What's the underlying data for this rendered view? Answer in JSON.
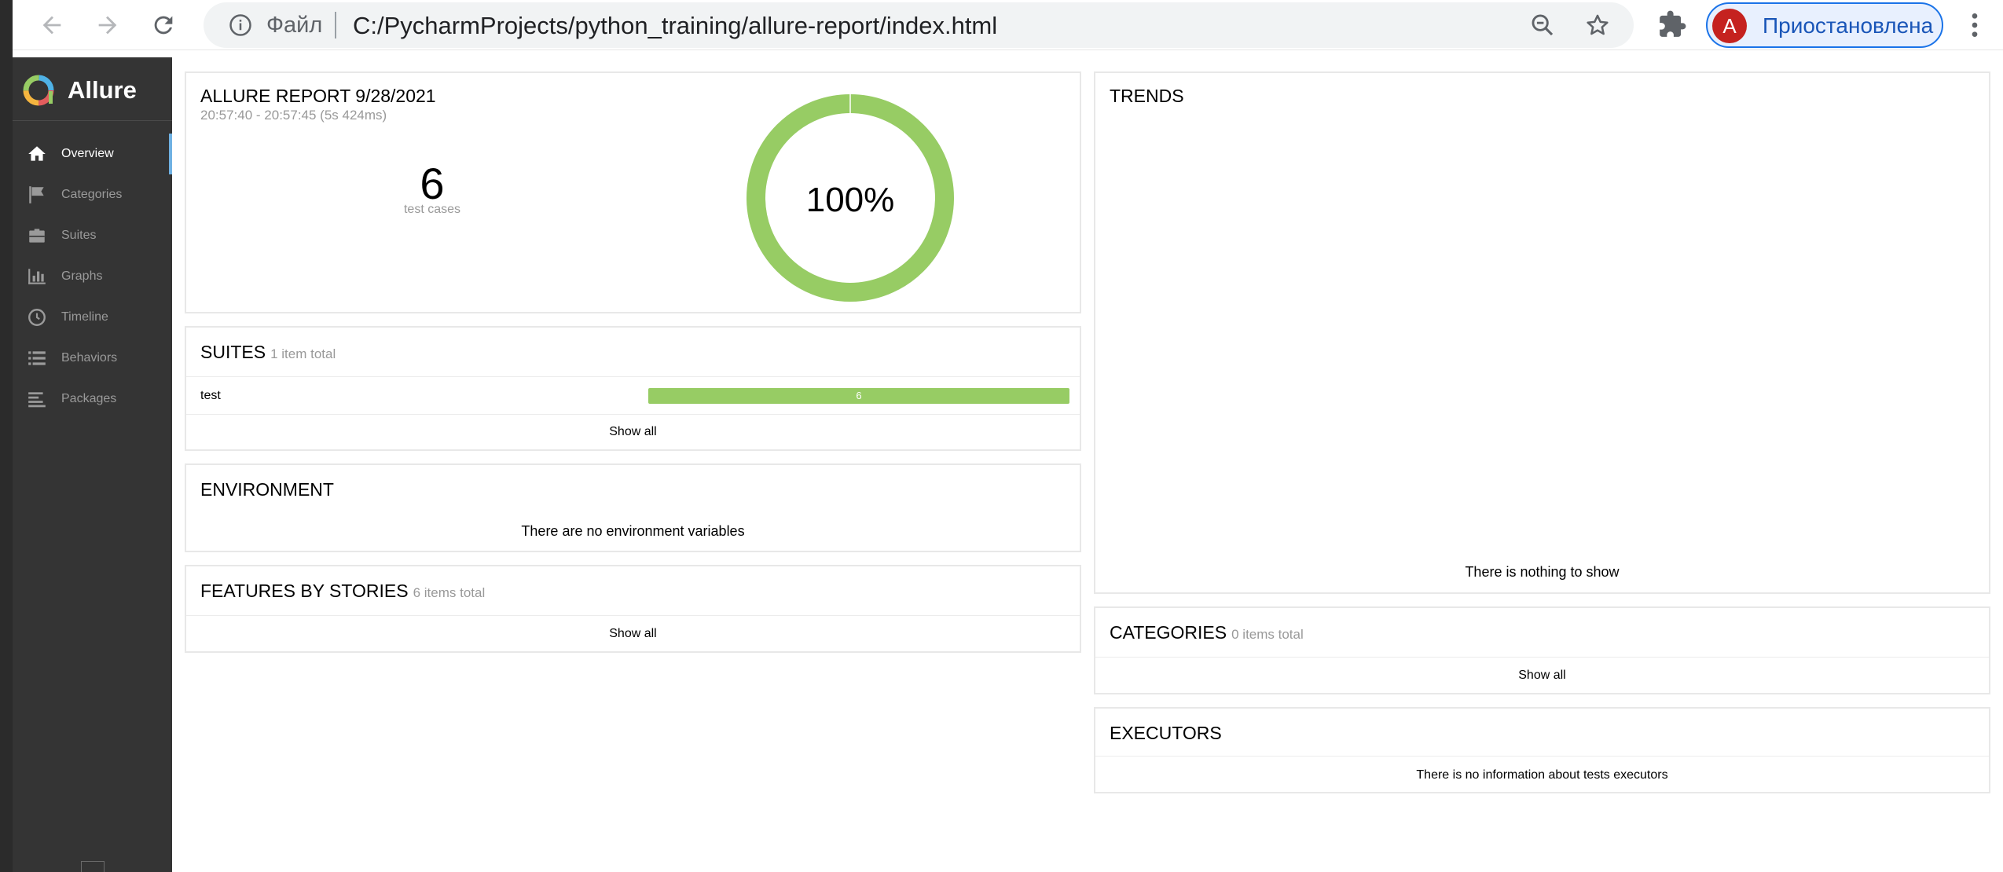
{
  "browser": {
    "scheme_label": "Файл",
    "url": "C:/PycharmProjects/python_training/allure-report/index.html",
    "profile_initial": "A",
    "profile_label": "Приостановлена",
    "icons": [
      "back-arrow-icon",
      "forward-arrow-icon",
      "reload-icon",
      "info-icon",
      "zoom-out-icon",
      "star-icon",
      "extensions-icon",
      "kebab-menu-icon"
    ]
  },
  "sidebar": {
    "brand": "Allure",
    "items": [
      {
        "label": "Overview",
        "icon": "home-icon",
        "active": true
      },
      {
        "label": "Categories",
        "icon": "flag-icon",
        "active": false
      },
      {
        "label": "Suites",
        "icon": "briefcase-icon",
        "active": false
      },
      {
        "label": "Graphs",
        "icon": "bar-chart-icon",
        "active": false
      },
      {
        "label": "Timeline",
        "icon": "clock-icon",
        "active": false
      },
      {
        "label": "Behaviors",
        "icon": "list-icon",
        "active": false
      },
      {
        "label": "Packages",
        "icon": "align-left-icon",
        "active": false
      }
    ]
  },
  "summary": {
    "title": "ALLURE REPORT 9/28/2021",
    "time_range": "20:57:40 - 20:57:45 (5s 424ms)",
    "test_count": "6",
    "test_count_label": "test cases",
    "pass_percent_label": "100%",
    "pass_fraction": 1.0,
    "pass_color": "#97cc64"
  },
  "suites": {
    "title": "SUITES",
    "count": "1 item total",
    "rows": [
      {
        "name": "test",
        "value": "6"
      }
    ],
    "show_all": "Show all"
  },
  "environment": {
    "title": "ENVIRONMENT",
    "empty": "There are no environment variables"
  },
  "features": {
    "title": "FEATURES BY STORIES",
    "count": "6 items total",
    "show_all": "Show all"
  },
  "trend": {
    "title": "TRENDS",
    "empty": "There is nothing to show"
  },
  "categories": {
    "title": "CATEGORIES",
    "count": "0 items total",
    "show_all": "Show all"
  },
  "executors": {
    "title": "EXECUTORS",
    "empty": "There is no information about tests executors"
  }
}
